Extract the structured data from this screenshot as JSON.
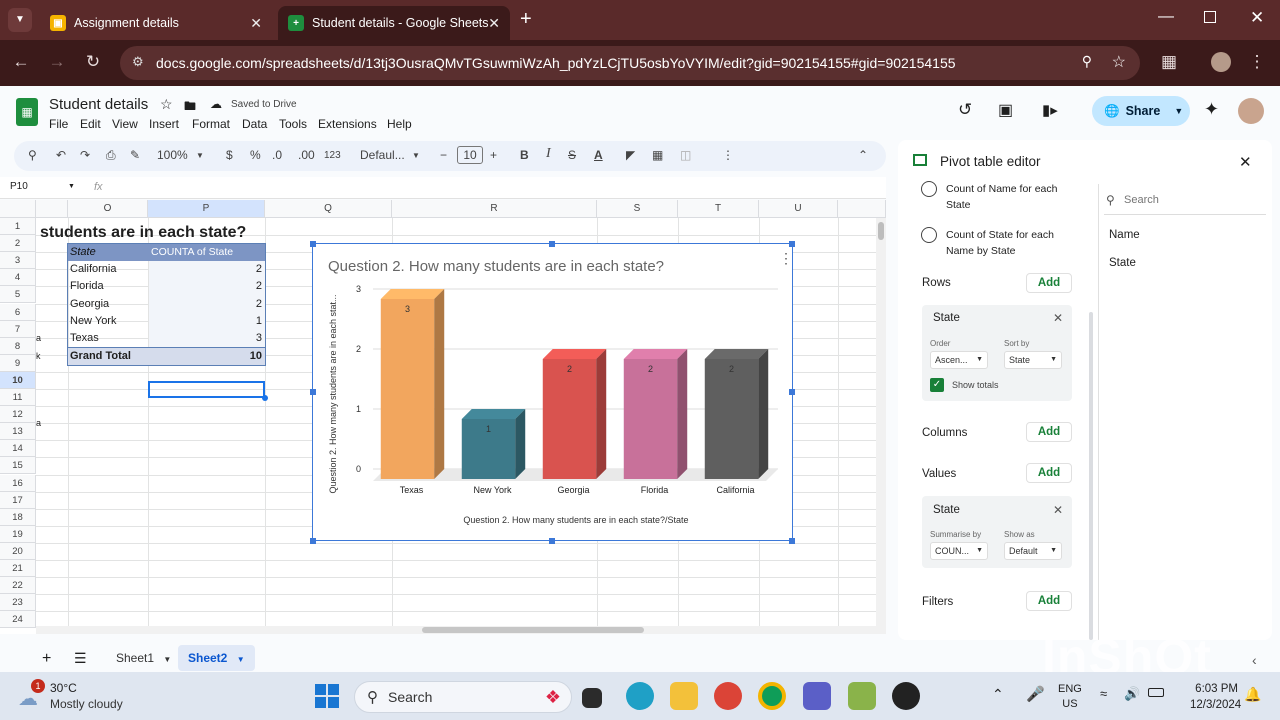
{
  "browser": {
    "tabs": [
      {
        "title": "Assignment details"
      },
      {
        "title": "Student details - Google Sheets"
      }
    ],
    "new_tab": "+",
    "url": "docs.google.com/spreadsheets/d/13tj3OusraQMvTGsuwmiWzAh_pdYzLCjTU5osbYoVYIM/edit?gid=902154155#gid=902154155"
  },
  "doc": {
    "title": "Student details",
    "saved": "Saved to Drive",
    "menus": [
      "File",
      "Edit",
      "View",
      "Insert",
      "Format",
      "Data",
      "Tools",
      "Extensions",
      "Help"
    ],
    "share": "Share"
  },
  "toolbar": {
    "zoom": "100%",
    "currency": "$",
    "percent": "%",
    "dec_minus": ".0",
    "dec_plus": ".00",
    "number_format": "123",
    "font": "Defaul...",
    "font_size": "10",
    "bold": "B",
    "italic": "I"
  },
  "formula": {
    "name_box": "P10",
    "fx": "fx"
  },
  "columns": [
    "O",
    "P",
    "Q",
    "R",
    "S",
    "T",
    "U"
  ],
  "rows": [
    "1",
    "2",
    "3",
    "4",
    "5",
    "6",
    "7",
    "8",
    "9",
    "10",
    "11",
    "12",
    "13",
    "14",
    "15",
    "16",
    "17",
    "18",
    "19",
    "20",
    "21",
    "22",
    "23",
    "24"
  ],
  "sheet": {
    "heading": "students are in each state?",
    "pivot_header": [
      "State",
      "COUNTA of State"
    ],
    "pivot_rows": [
      {
        "state": "California",
        "count": "2"
      },
      {
        "state": "Florida",
        "count": "2"
      },
      {
        "state": "Georgia",
        "count": "2"
      },
      {
        "state": "New York",
        "count": "1"
      },
      {
        "state": "Texas",
        "count": "3"
      }
    ],
    "grand_total": {
      "label": "Grand Total",
      "value": "10"
    },
    "partial_n": [
      "a",
      "k",
      "a"
    ]
  },
  "chart_data": {
    "type": "bar",
    "title": "Question 2. How many students are in each state?",
    "xlabel": "Question 2. How many students are in each state?/State",
    "ylabel": "Question 2. How many students are in each stat...",
    "categories": [
      "Texas",
      "New York",
      "Georgia",
      "Florida",
      "California"
    ],
    "values": [
      3,
      1,
      2,
      2,
      2
    ],
    "colors": [
      "#f2a65e",
      "#3d7a8a",
      "#d9534f",
      "#c8719a",
      "#5f5f5f"
    ],
    "yticks": [
      "0",
      "1",
      "2",
      "3"
    ],
    "ylim": [
      0,
      3
    ],
    "grid": true
  },
  "sheet_tabs": [
    "Sheet1",
    "Sheet2"
  ],
  "panel": {
    "title": "Pivot table editor",
    "suggestions": [
      "Count of Name for each State",
      "Count of State for each Name by State"
    ],
    "search_placeholder": "Search",
    "fields": [
      "Name",
      "State"
    ],
    "rows_label": "Rows",
    "columns_label": "Columns",
    "values_label": "Values",
    "filters_label": "Filters",
    "add": "Add",
    "row_card": {
      "name": "State",
      "order_label": "Order",
      "order_value": "Ascen...",
      "sort_label": "Sort by",
      "sort_value": "State",
      "show_totals": "Show totals"
    },
    "value_card": {
      "name": "State",
      "summarise_label": "Summarise by",
      "summarise_value": "COUN...",
      "show_as_label": "Show as",
      "show_as_value": "Default"
    }
  },
  "taskbar": {
    "weather_temp": "30°C",
    "weather_desc": "Mostly cloudy",
    "weather_badge": "1",
    "search": "Search",
    "lang1": "ENG",
    "lang2": "US",
    "time": "6:03 PM",
    "date": "12/3/2024"
  },
  "watermark": "InShOt"
}
